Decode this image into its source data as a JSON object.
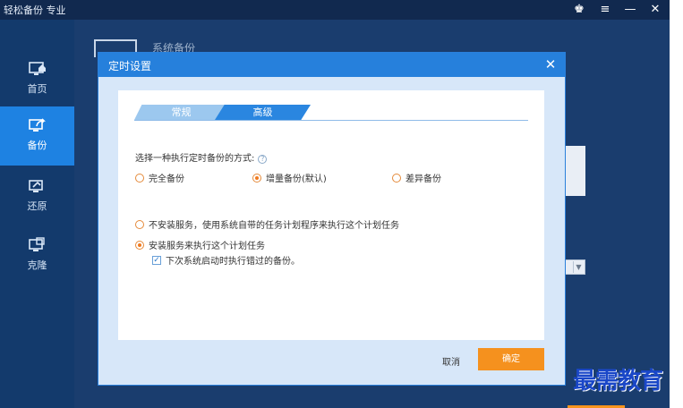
{
  "app": {
    "title": "轻松备份 专业",
    "controls": {
      "crown": "♚",
      "menu": "≡",
      "minimize": "—",
      "close": "✕"
    }
  },
  "sidebar": {
    "items": [
      {
        "label": "首页",
        "icon": "monitor-home-icon",
        "active": false
      },
      {
        "label": "备份",
        "icon": "backup-icon",
        "active": true
      },
      {
        "label": "还原",
        "icon": "restore-icon",
        "active": false
      },
      {
        "label": "克隆",
        "icon": "clone-icon",
        "active": false
      }
    ]
  },
  "content": {
    "title": "系统备份"
  },
  "dialog": {
    "title": "定时设置",
    "close": "✕",
    "tabs": [
      {
        "label": "常规",
        "active": false
      },
      {
        "label": "高级",
        "active": true
      }
    ],
    "question": "选择一种执行定时备份的方式:",
    "help": "?",
    "backup_methods": [
      {
        "label": "完全备份",
        "checked": false
      },
      {
        "label": "增量备份(默认)",
        "checked": true
      },
      {
        "label": "差异备份",
        "checked": false
      }
    ],
    "service_options": [
      {
        "label": "不安装服务，使用系统自带的任务计划程序来执行这个计划任务",
        "checked": false
      },
      {
        "label": "安装服务来执行这个计划任务",
        "checked": true
      }
    ],
    "run_missed": {
      "label": "下次系统启动时执行错过的备份。",
      "checked": true
    },
    "cancel_label": "取消",
    "ok_label": "确定"
  },
  "watermark": "最需教育",
  "colors": {
    "accent": "#2680dc",
    "ok_button": "#f5911e",
    "radio_checked": "#f07a1f",
    "sidebar_active": "#1e82e2"
  }
}
